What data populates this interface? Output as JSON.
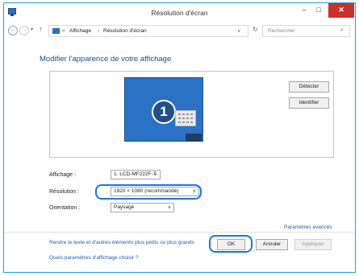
{
  "window": {
    "title": "Résolution d'écran",
    "minimize_glyph": "–",
    "maximize_glyph": "□",
    "close_glyph": "✕"
  },
  "nav": {
    "back_glyph": "←",
    "forward_glyph": "→",
    "dropdown_glyph": "▾",
    "up_glyph": "↑",
    "refresh_glyph": "↻",
    "search_glyph": "⌕"
  },
  "address": {
    "separator": "«",
    "crumbs": [
      "Affichage",
      "Résolution d'écran"
    ],
    "crumb_separator": "›",
    "dropdown_glyph": "∨"
  },
  "search": {
    "placeholder": "Rechercher"
  },
  "page": {
    "title": "Modifier l'apparence de votre affichage",
    "monitor_number": "1",
    "detect_label": "Détecter",
    "identify_label": "Identifier"
  },
  "form": {
    "display_label": "Affichage :",
    "display_value": "1. LCD-MF222F-T",
    "resolution_label": "Résolution :",
    "resolution_value": "1920 × 1080 (recommandé)",
    "orientation_label": "Orientation :",
    "orientation_value": "Paysage",
    "select_arrow": "∨"
  },
  "links": {
    "advanced": "Paramètres avancés",
    "text_size": "Rendre le texte et d'autres éléments plus petits ou plus grands",
    "which_settings": "Quels paramètres d'affichage choisir ?"
  },
  "buttons": {
    "ok": "OK",
    "cancel": "Annuler",
    "apply": "Appliquer"
  },
  "colors": {
    "accent": "#1c75e6",
    "monitor": "#2b72c4",
    "close": "#c7312c",
    "link": "#1c5fb2"
  }
}
